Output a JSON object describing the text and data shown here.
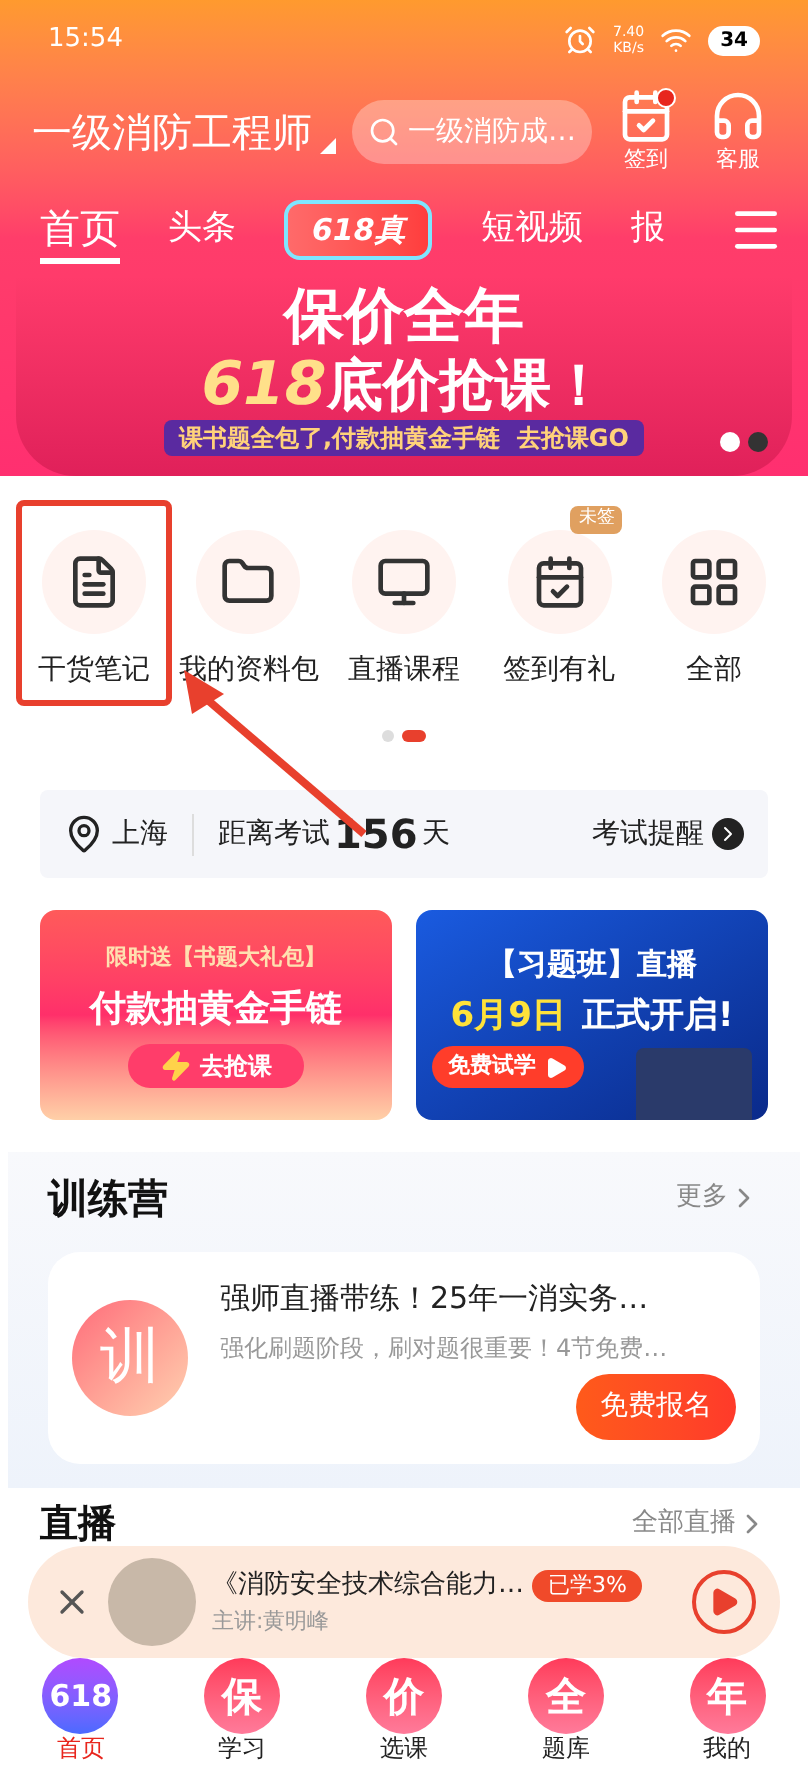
{
  "status_bar": {
    "time": "15:54",
    "speed": "7.40\nKB/s",
    "battery": "34"
  },
  "header": {
    "title": "一级消防工程师",
    "search": {
      "placeholder": "一级消防成…"
    },
    "actions": [
      {
        "kind": "checkin",
        "label": "签到",
        "badge": true
      },
      {
        "kind": "service",
        "label": "客服",
        "badge": false
      }
    ]
  },
  "tabs": [
    {
      "label": "首页",
      "selected": true,
      "kind": "text"
    },
    {
      "label": "头条",
      "selected": false,
      "kind": "text"
    },
    {
      "label": "618真",
      "selected": false,
      "kind": "promo"
    },
    {
      "label": "短视频",
      "selected": false,
      "kind": "text"
    },
    {
      "label": "报",
      "selected": false,
      "kind": "text"
    }
  ],
  "hero_banner": {
    "line1": "保价全年",
    "line2_number": "618",
    "line2": "底价抢课！",
    "subtitle": "课书题全包了,付款抽黄金手链  去抢课GO",
    "pages": [
      {
        "selected": false
      },
      {
        "selected": true
      }
    ]
  },
  "shortcuts": [
    {
      "kind": "notes",
      "label": "干货笔记",
      "highlighted": true
    },
    {
      "kind": "folder",
      "label": "我的资料包",
      "highlighted": false
    },
    {
      "kind": "live",
      "label": "直播课程",
      "highlighted": false
    },
    {
      "kind": "calendar",
      "label": "签到有礼",
      "highlighted": false,
      "badge": "未签"
    },
    {
      "kind": "grid",
      "label": "全部",
      "highlighted": false
    }
  ],
  "shortcut_pages": [
    {
      "selected": false
    },
    {
      "selected": true
    }
  ],
  "exam_bar": {
    "city": "上海",
    "countdown_label": "距离考试",
    "days": "156",
    "unit": "天",
    "reminder": "考试提醒"
  },
  "promo_banners": [
    {
      "kind": "gift",
      "top": "限时送【书题大礼包】",
      "headline": "付款抽黄金手链",
      "button": "去抢课"
    },
    {
      "kind": "live",
      "top": "【习题班】直播",
      "date": "6月9日",
      "headline": "正式开启!",
      "button": "免费试学"
    }
  ],
  "training_camp": {
    "title": "训练营",
    "more": "更多",
    "card": {
      "avatar": "训",
      "title": "强师直播带练！25年一消实务…",
      "subtitle": "强化刷题阶段，刷对题很重要！4节免费…",
      "button": "免费报名"
    }
  },
  "live": {
    "title": "直播",
    "more": "全部直播"
  },
  "mini_player": {
    "title": "《消防安全技术综合能力…",
    "lecturer": "主讲:黄明峰",
    "progress": "已学3%"
  },
  "bottom_nav": [
    {
      "icon": "618",
      "label": "首页",
      "selected": true
    },
    {
      "icon": "保",
      "label": "学习",
      "selected": false
    },
    {
      "icon": "价",
      "label": "选课",
      "selected": false
    },
    {
      "icon": "全",
      "label": "题库",
      "selected": false
    },
    {
      "icon": "年",
      "label": "我的",
      "selected": false
    }
  ]
}
